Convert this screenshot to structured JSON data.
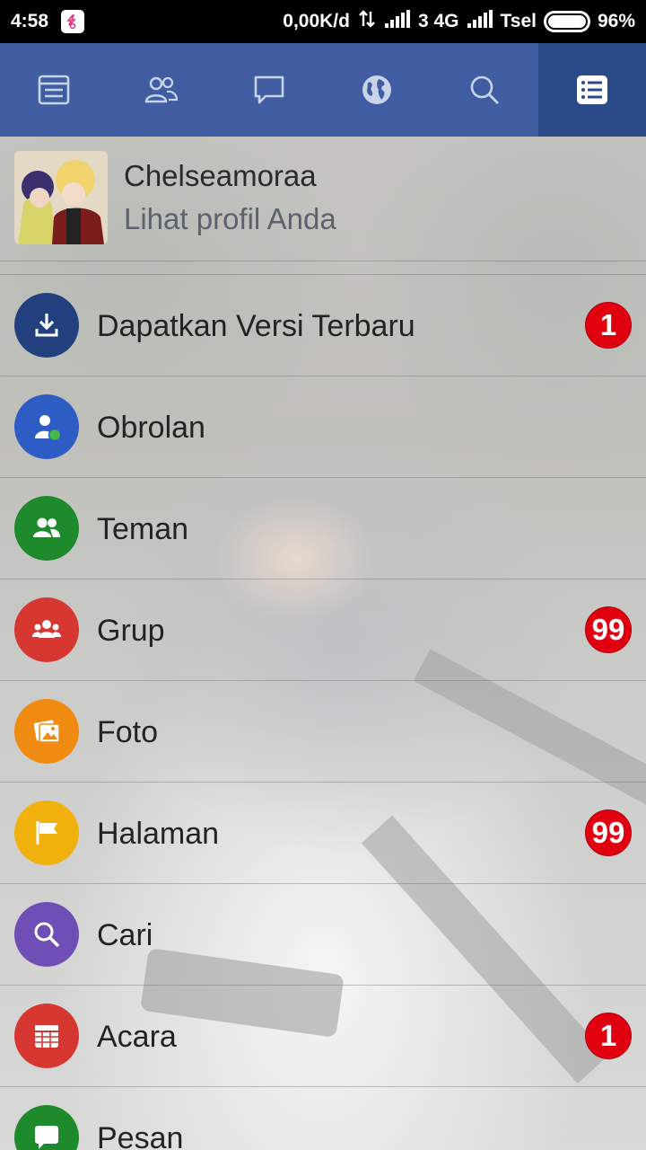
{
  "status_bar": {
    "time": "4:58",
    "speed": "0,00K/d",
    "network": "3 4G",
    "carrier": "Tsel",
    "battery": "96%"
  },
  "nav": {
    "tabs": [
      {
        "icon": "news-feed-icon",
        "active": false
      },
      {
        "icon": "friend-requests-icon",
        "active": false
      },
      {
        "icon": "messages-icon",
        "active": false
      },
      {
        "icon": "globe-icon",
        "active": false
      },
      {
        "icon": "search-icon",
        "active": false
      },
      {
        "icon": "menu-list-icon",
        "active": true
      }
    ]
  },
  "profile": {
    "name": "Chelseamoraa",
    "subtitle": "Lihat profil Anda"
  },
  "menu": {
    "items": [
      {
        "label": "Dapatkan Versi Terbaru",
        "icon": "download-icon",
        "color": "#23407e",
        "badge": "1"
      },
      {
        "label": "Obrolan",
        "icon": "chat-person-icon",
        "color": "#2d5cc4",
        "badge": ""
      },
      {
        "label": "Teman",
        "icon": "friends-icon",
        "color": "#1e8a2c",
        "badge": ""
      },
      {
        "label": "Grup",
        "icon": "group-icon",
        "color": "#d63730",
        "badge": "99"
      },
      {
        "label": "Foto",
        "icon": "photo-icon",
        "color": "#f18a11",
        "badge": ""
      },
      {
        "label": "Halaman",
        "icon": "flag-icon",
        "color": "#f0b10d",
        "badge": "99"
      },
      {
        "label": "Cari",
        "icon": "search-icon",
        "color": "#6f4fb6",
        "badge": ""
      },
      {
        "label": "Acara",
        "icon": "calendar-icon",
        "color": "#d63730",
        "badge": "1"
      },
      {
        "label": "Pesan",
        "icon": "message-bubble-icon",
        "color": "#1e8a2c",
        "badge": ""
      }
    ]
  },
  "colors": {
    "nav_bg": "#3f5da0",
    "nav_active": "#2b4a88",
    "badge": "#e00010"
  }
}
